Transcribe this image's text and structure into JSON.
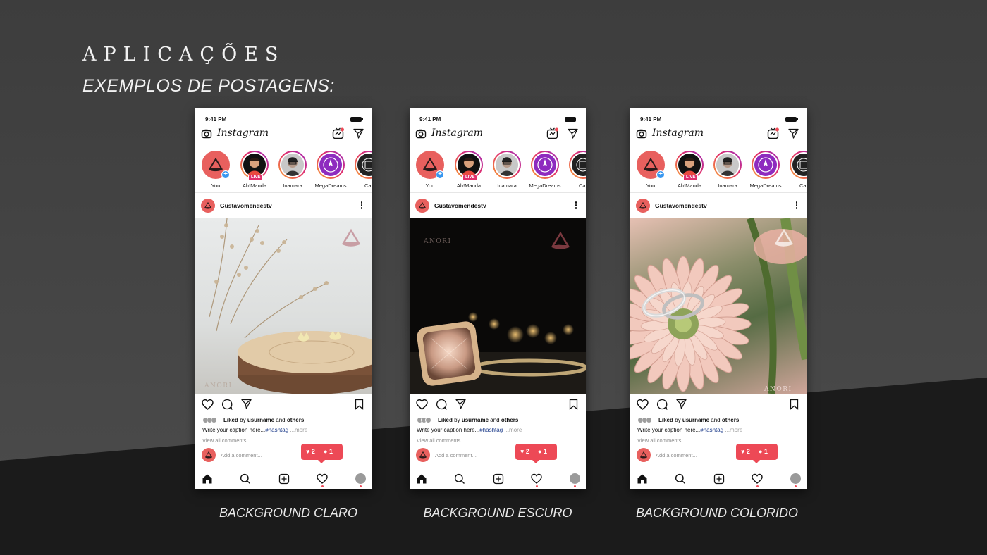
{
  "page": {
    "title": "APLICAÇÕES",
    "subtitle": "EXEMPLOS DE POSTAGENS:"
  },
  "phones": [
    {
      "label": "BACKGROUND CLARO",
      "background": "light",
      "watermark": "ANORI"
    },
    {
      "label": "BACKGROUND ESCURO",
      "background": "dark",
      "watermark": "ANORI"
    },
    {
      "label": "BACKGROUND COLORIDO",
      "background": "colorful",
      "watermark": "ANORI"
    }
  ],
  "app": {
    "time": "9:41 PM",
    "logo": "Instagram",
    "stories": [
      {
        "name": "You"
      },
      {
        "name": "Ah!Manda",
        "badge": "LIVE"
      },
      {
        "name": "Inamara"
      },
      {
        "name": "MegaDreams"
      },
      {
        "name": "Car"
      }
    ],
    "post": {
      "username": "Gustavomendestv",
      "liked_prefix": "Liked",
      "liked_by": " by ",
      "liked_user": "usurname",
      "liked_and": " and ",
      "liked_others": "others",
      "caption": "Write your caption here...",
      "hashtag": "#hashtag",
      "more": " ...more",
      "view_all": "View all comments",
      "add_comment": "Add a comment..."
    },
    "notification": {
      "likes": "2",
      "comments": "1"
    }
  },
  "colors": {
    "brand": "#e8605e",
    "notification": "#ed4956",
    "hashtag": "#1c3b8a",
    "story_ring_start": "#f9a12e",
    "story_ring_end": "#9b2cbf"
  }
}
